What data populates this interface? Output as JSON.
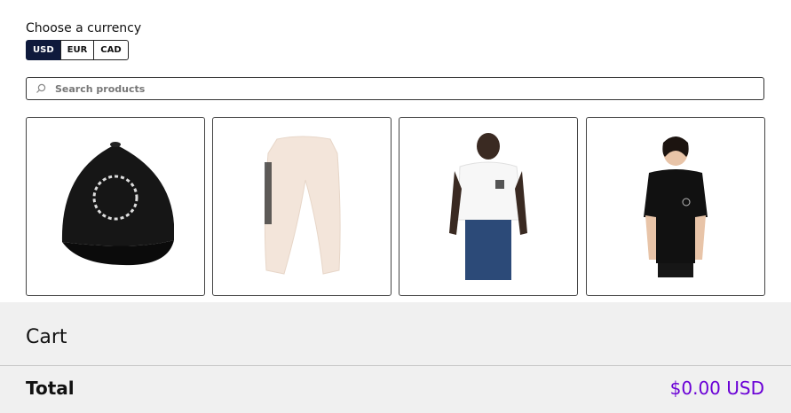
{
  "currency": {
    "label": "Choose a currency",
    "options": [
      "USD",
      "EUR",
      "CAD"
    ],
    "selected": "USD"
  },
  "search": {
    "placeholder": "Search products",
    "value": ""
  },
  "products": [
    {
      "image": "black-dad-hat",
      "label_art": "Hello, World!"
    },
    {
      "image": "cream-joggers"
    },
    {
      "image": "man-white-tshirt"
    },
    {
      "image": "woman-black-tshirt"
    }
  ],
  "cart": {
    "title": "Cart",
    "total_label": "Total",
    "total_value": "$0.00 USD"
  },
  "colors": {
    "accent": "#6a00d6",
    "selected_currency_bg": "#0f1a3c",
    "cart_bg": "#f0f0f0"
  }
}
